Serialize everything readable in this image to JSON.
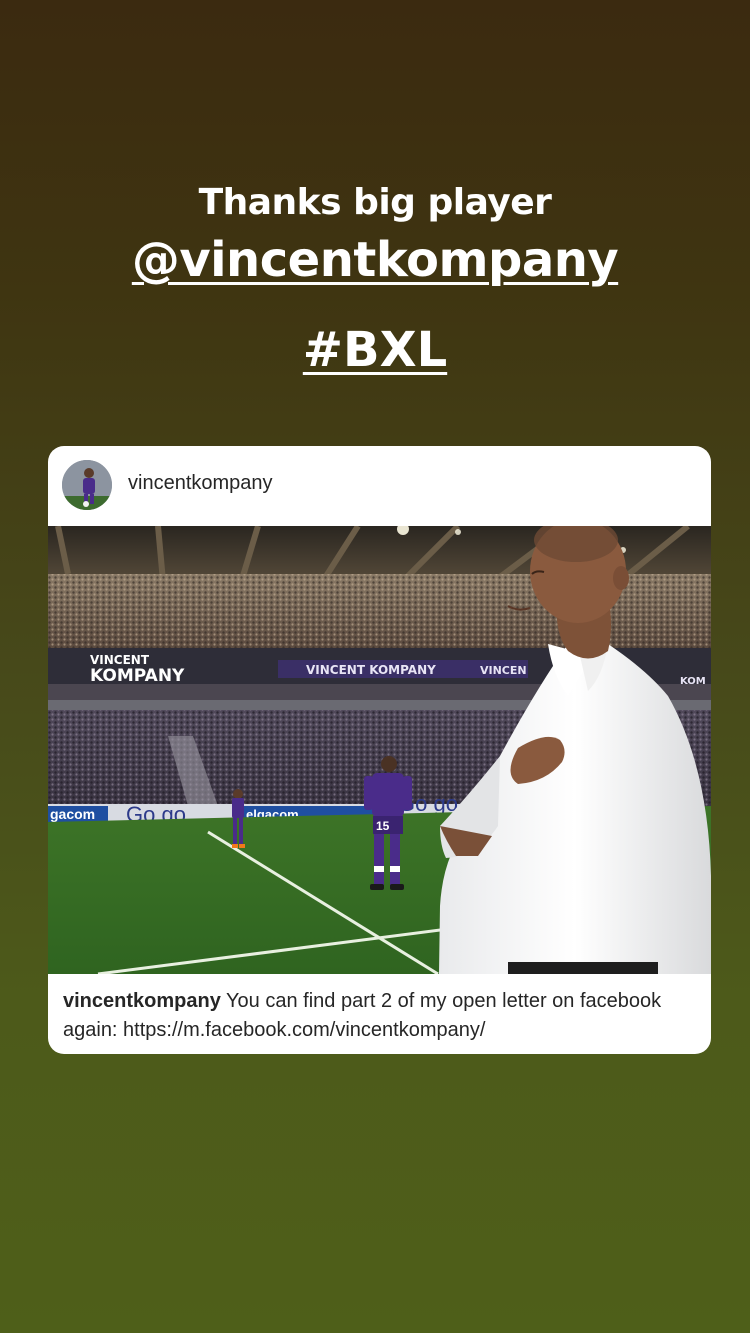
{
  "story": {
    "line1": "Thanks big player",
    "mention": "@vincentkompany",
    "hashtag": "#BXL"
  },
  "post": {
    "username": "vincentkompany",
    "banner_text_1": "VINCENT",
    "banner_text_2": "KOMPANY",
    "banner_text_3": "VINCENT KOMPANY",
    "banner_text_4": "VINCEN",
    "banner_text_5": "KOM",
    "ad_text_1": "gacom",
    "ad_text_2": "Go go",
    "ad_text_3": "elgacom",
    "ad_text_4": "Go go",
    "shirt_number": "15",
    "caption_user": "vincentkompany",
    "caption_text": "You can find part 2 of my open letter on facebook again: https://m.facebook.com/vincentkompany/"
  },
  "colors": {
    "background_top": "#3b2a10",
    "background_bottom": "#4e5f19",
    "card": "#ffffff",
    "pitch": "#3f7a27",
    "kit_purple": "#4a2c8a"
  }
}
